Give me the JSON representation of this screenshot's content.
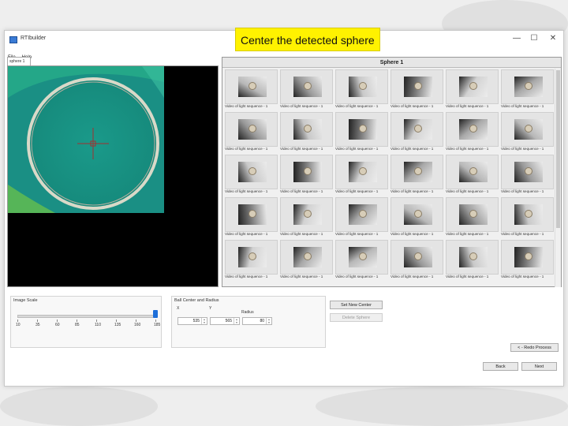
{
  "caption": "Center the detected sphere",
  "window": {
    "title": "RTIbuilder",
    "minimize": "—",
    "maximize": "☐",
    "close": "✕"
  },
  "menu": [
    "File",
    "Help"
  ],
  "left_tab": "sphere 1",
  "right_header": "Sphere 1",
  "thumbnail_label": "Video of light sequence - 1",
  "thumbnail_count": 30,
  "image_scale": {
    "title": "Image Scale",
    "ticks": [
      "10",
      "35",
      "60",
      "85",
      "110",
      "135",
      "160",
      "185"
    ],
    "value": 185
  },
  "ball": {
    "title": "Ball Center and Radius",
    "x_label": "X",
    "y_label": "Y",
    "radius_label": "Radius",
    "x_value": "535",
    "y_value": "565",
    "radius_value": "80"
  },
  "buttons": {
    "set_center": "Set New Center",
    "delete_sphere": "Delete Sphere",
    "redo": "< - Redo Process",
    "back": "Back",
    "next": "Next"
  },
  "colors": {
    "sphere_bg": "#1a9a8a",
    "ring": "#d9d9c8",
    "crosshair": "#a33030",
    "accent": "#1e6fd9",
    "caption_bg": "#fff200"
  }
}
